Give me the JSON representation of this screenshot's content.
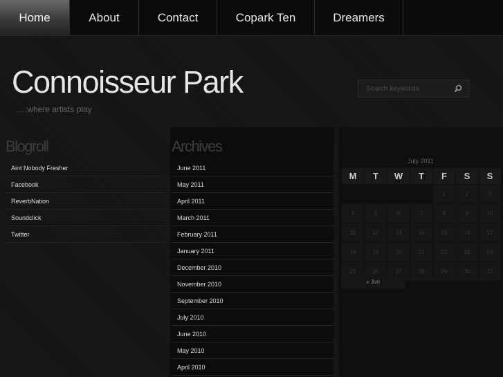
{
  "nav": {
    "items": [
      {
        "label": "Home",
        "active": true
      },
      {
        "label": "About"
      },
      {
        "label": "Contact"
      },
      {
        "label": "Copark Ten"
      },
      {
        "label": "Dreamers"
      }
    ]
  },
  "header": {
    "title": "Connoisseur Park",
    "tagline": "….where artists play"
  },
  "search": {
    "placeholder": "Search keywords",
    "icon": "search-icon"
  },
  "blogroll": {
    "title": "Blogroll",
    "links": [
      "Aint Nobody Fresher",
      "Facebook",
      "ReverbNation",
      "Soundclick",
      "Twitter"
    ]
  },
  "archives": {
    "title": "Archives",
    "links": [
      "June 2011",
      "May 2011",
      "April 2011",
      "March 2011",
      "February 2011",
      "January 2011",
      "December 2010",
      "November 2010",
      "September 2010",
      "July 2010",
      "June 2010",
      "May 2010",
      "April 2010"
    ]
  },
  "calendar": {
    "caption": "July 2011",
    "weekdays": [
      "M",
      "T",
      "W",
      "T",
      "F",
      "S",
      "S"
    ],
    "weeks": [
      [
        "",
        "",
        "",
        "",
        "1",
        "2",
        "3"
      ],
      [
        "4",
        "5",
        "6",
        "7",
        "8",
        "9",
        "10"
      ],
      [
        "11",
        "12",
        "13",
        "14",
        "15",
        "16",
        "17"
      ],
      [
        "18",
        "19",
        "20",
        "21",
        "22",
        "23",
        "24"
      ],
      [
        "25",
        "26",
        "27",
        "28",
        "29",
        "30",
        "31"
      ]
    ],
    "prev_link": "« Jun"
  }
}
